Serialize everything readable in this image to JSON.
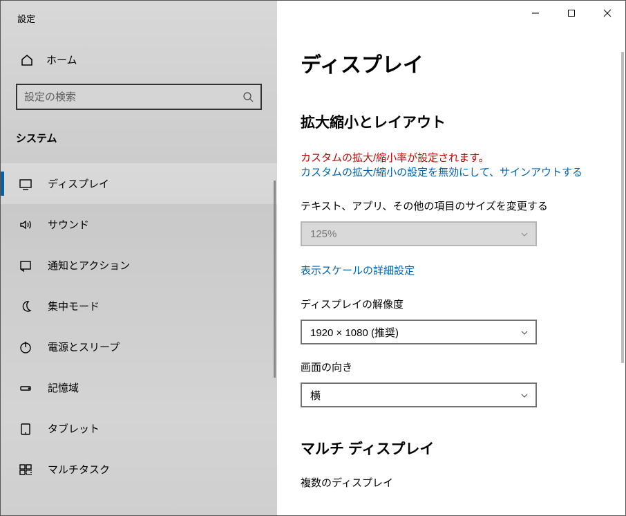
{
  "app_title": "設定",
  "home_label": "ホーム",
  "search_placeholder": "設定の検索",
  "category_label": "システム",
  "sidebar_items": [
    {
      "id": "display",
      "label": "ディスプレイ",
      "active": true
    },
    {
      "id": "sound",
      "label": "サウンド",
      "active": false
    },
    {
      "id": "notif",
      "label": "通知とアクション",
      "active": false
    },
    {
      "id": "focus",
      "label": "集中モード",
      "active": false
    },
    {
      "id": "power",
      "label": "電源とスリープ",
      "active": false
    },
    {
      "id": "storage",
      "label": "記憶域",
      "active": false
    },
    {
      "id": "tablet",
      "label": "タブレット",
      "active": false
    },
    {
      "id": "multitask",
      "label": "マルチタスク",
      "active": false
    }
  ],
  "page": {
    "title": "ディスプレイ",
    "scale_heading": "拡大縮小とレイアウト",
    "custom_scale_warn": "カスタムの拡大/縮小率が設定されます。",
    "custom_scale_link": "カスタムの拡大/縮小の設定を無効にして、サインアウトする",
    "size_label": "テキスト、アプリ、その他の項目のサイズを変更する",
    "size_value": "125%",
    "advanced_scale_link": "表示スケールの詳細設定",
    "resolution_label": "ディスプレイの解像度",
    "resolution_value": "1920 × 1080 (推奨)",
    "orientation_label": "画面の向き",
    "orientation_value": "横",
    "multidisplay_heading": "マルチ ディスプレイ",
    "multidisplay_sublabel": "複数のディスプレイ"
  }
}
